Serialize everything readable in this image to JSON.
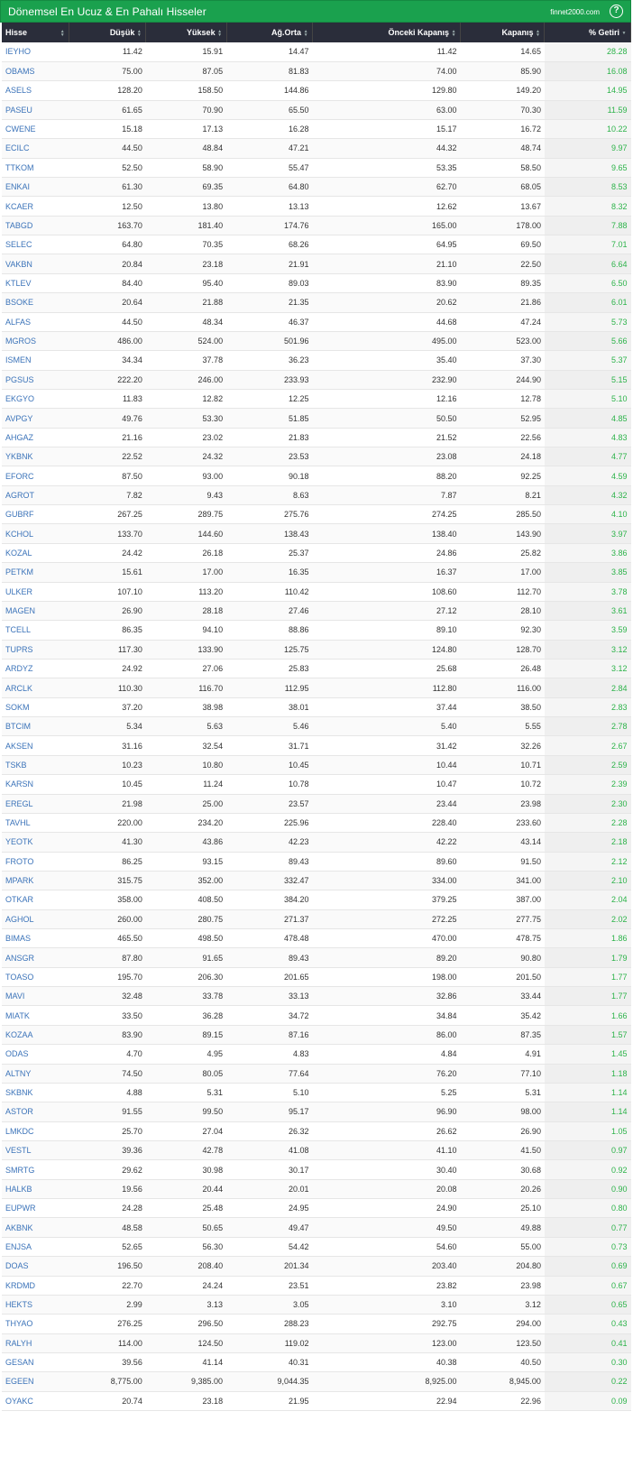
{
  "header": {
    "title": "Dönemsel En Ucuz & En Pahalı Hisseler",
    "site": "finnet2000.com",
    "help_icon": "?"
  },
  "columns": [
    "Hisse",
    "Düşük",
    "Yüksek",
    "Ağ.Orta",
    "Önceki Kapanış",
    "Kapanış",
    "% Getiri"
  ],
  "colors": {
    "header_bg": "#1aa14e",
    "thead_bg": "#2a2d3a",
    "symbol": "#3b73b9",
    "positive": "#2db34a"
  },
  "rows": [
    [
      "IEYHO",
      "11.42",
      "15.91",
      "14.47",
      "11.42",
      "14.65",
      "28.28"
    ],
    [
      "OBAMS",
      "75.00",
      "87.05",
      "81.83",
      "74.00",
      "85.90",
      "16.08"
    ],
    [
      "ASELS",
      "128.20",
      "158.50",
      "144.86",
      "129.80",
      "149.20",
      "14.95"
    ],
    [
      "PASEU",
      "61.65",
      "70.90",
      "65.50",
      "63.00",
      "70.30",
      "11.59"
    ],
    [
      "CWENE",
      "15.18",
      "17.13",
      "16.28",
      "15.17",
      "16.72",
      "10.22"
    ],
    [
      "ECILC",
      "44.50",
      "48.84",
      "47.21",
      "44.32",
      "48.74",
      "9.97"
    ],
    [
      "TTKOM",
      "52.50",
      "58.90",
      "55.47",
      "53.35",
      "58.50",
      "9.65"
    ],
    [
      "ENKAI",
      "61.30",
      "69.35",
      "64.80",
      "62.70",
      "68.05",
      "8.53"
    ],
    [
      "KCAER",
      "12.50",
      "13.80",
      "13.13",
      "12.62",
      "13.67",
      "8.32"
    ],
    [
      "TABGD",
      "163.70",
      "181.40",
      "174.76",
      "165.00",
      "178.00",
      "7.88"
    ],
    [
      "SELEC",
      "64.80",
      "70.35",
      "68.26",
      "64.95",
      "69.50",
      "7.01"
    ],
    [
      "VAKBN",
      "20.84",
      "23.18",
      "21.91",
      "21.10",
      "22.50",
      "6.64"
    ],
    [
      "KTLEV",
      "84.40",
      "95.40",
      "89.03",
      "83.90",
      "89.35",
      "6.50"
    ],
    [
      "BSOKE",
      "20.64",
      "21.88",
      "21.35",
      "20.62",
      "21.86",
      "6.01"
    ],
    [
      "ALFAS",
      "44.50",
      "48.34",
      "46.37",
      "44.68",
      "47.24",
      "5.73"
    ],
    [
      "MGROS",
      "486.00",
      "524.00",
      "501.96",
      "495.00",
      "523.00",
      "5.66"
    ],
    [
      "ISMEN",
      "34.34",
      "37.78",
      "36.23",
      "35.40",
      "37.30",
      "5.37"
    ],
    [
      "PGSUS",
      "222.20",
      "246.00",
      "233.93",
      "232.90",
      "244.90",
      "5.15"
    ],
    [
      "EKGYO",
      "11.83",
      "12.82",
      "12.25",
      "12.16",
      "12.78",
      "5.10"
    ],
    [
      "AVPGY",
      "49.76",
      "53.30",
      "51.85",
      "50.50",
      "52.95",
      "4.85"
    ],
    [
      "AHGAZ",
      "21.16",
      "23.02",
      "21.83",
      "21.52",
      "22.56",
      "4.83"
    ],
    [
      "YKBNK",
      "22.52",
      "24.32",
      "23.53",
      "23.08",
      "24.18",
      "4.77"
    ],
    [
      "EFORC",
      "87.50",
      "93.00",
      "90.18",
      "88.20",
      "92.25",
      "4.59"
    ],
    [
      "AGROT",
      "7.82",
      "9.43",
      "8.63",
      "7.87",
      "8.21",
      "4.32"
    ],
    [
      "GUBRF",
      "267.25",
      "289.75",
      "275.76",
      "274.25",
      "285.50",
      "4.10"
    ],
    [
      "KCHOL",
      "133.70",
      "144.60",
      "138.43",
      "138.40",
      "143.90",
      "3.97"
    ],
    [
      "KOZAL",
      "24.42",
      "26.18",
      "25.37",
      "24.86",
      "25.82",
      "3.86"
    ],
    [
      "PETKM",
      "15.61",
      "17.00",
      "16.35",
      "16.37",
      "17.00",
      "3.85"
    ],
    [
      "ULKER",
      "107.10",
      "113.20",
      "110.42",
      "108.60",
      "112.70",
      "3.78"
    ],
    [
      "MAGEN",
      "26.90",
      "28.18",
      "27.46",
      "27.12",
      "28.10",
      "3.61"
    ],
    [
      "TCELL",
      "86.35",
      "94.10",
      "88.86",
      "89.10",
      "92.30",
      "3.59"
    ],
    [
      "TUPRS",
      "117.30",
      "133.90",
      "125.75",
      "124.80",
      "128.70",
      "3.12"
    ],
    [
      "ARDYZ",
      "24.92",
      "27.06",
      "25.83",
      "25.68",
      "26.48",
      "3.12"
    ],
    [
      "ARCLK",
      "110.30",
      "116.70",
      "112.95",
      "112.80",
      "116.00",
      "2.84"
    ],
    [
      "SOKM",
      "37.20",
      "38.98",
      "38.01",
      "37.44",
      "38.50",
      "2.83"
    ],
    [
      "BTCIM",
      "5.34",
      "5.63",
      "5.46",
      "5.40",
      "5.55",
      "2.78"
    ],
    [
      "AKSEN",
      "31.16",
      "32.54",
      "31.71",
      "31.42",
      "32.26",
      "2.67"
    ],
    [
      "TSKB",
      "10.23",
      "10.80",
      "10.45",
      "10.44",
      "10.71",
      "2.59"
    ],
    [
      "KARSN",
      "10.45",
      "11.24",
      "10.78",
      "10.47",
      "10.72",
      "2.39"
    ],
    [
      "EREGL",
      "21.98",
      "25.00",
      "23.57",
      "23.44",
      "23.98",
      "2.30"
    ],
    [
      "TAVHL",
      "220.00",
      "234.20",
      "225.96",
      "228.40",
      "233.60",
      "2.28"
    ],
    [
      "YEOTK",
      "41.30",
      "43.86",
      "42.23",
      "42.22",
      "43.14",
      "2.18"
    ],
    [
      "FROTO",
      "86.25",
      "93.15",
      "89.43",
      "89.60",
      "91.50",
      "2.12"
    ],
    [
      "MPARK",
      "315.75",
      "352.00",
      "332.47",
      "334.00",
      "341.00",
      "2.10"
    ],
    [
      "OTKAR",
      "358.00",
      "408.50",
      "384.20",
      "379.25",
      "387.00",
      "2.04"
    ],
    [
      "AGHOL",
      "260.00",
      "280.75",
      "271.37",
      "272.25",
      "277.75",
      "2.02"
    ],
    [
      "BIMAS",
      "465.50",
      "498.50",
      "478.48",
      "470.00",
      "478.75",
      "1.86"
    ],
    [
      "ANSGR",
      "87.80",
      "91.65",
      "89.43",
      "89.20",
      "90.80",
      "1.79"
    ],
    [
      "TOASO",
      "195.70",
      "206.30",
      "201.65",
      "198.00",
      "201.50",
      "1.77"
    ],
    [
      "MAVI",
      "32.48",
      "33.78",
      "33.13",
      "32.86",
      "33.44",
      "1.77"
    ],
    [
      "MIATK",
      "33.50",
      "36.28",
      "34.72",
      "34.84",
      "35.42",
      "1.66"
    ],
    [
      "KOZAA",
      "83.90",
      "89.15",
      "87.16",
      "86.00",
      "87.35",
      "1.57"
    ],
    [
      "ODAS",
      "4.70",
      "4.95",
      "4.83",
      "4.84",
      "4.91",
      "1.45"
    ],
    [
      "ALTNY",
      "74.50",
      "80.05",
      "77.64",
      "76.20",
      "77.10",
      "1.18"
    ],
    [
      "SKBNK",
      "4.88",
      "5.31",
      "5.10",
      "5.25",
      "5.31",
      "1.14"
    ],
    [
      "ASTOR",
      "91.55",
      "99.50",
      "95.17",
      "96.90",
      "98.00",
      "1.14"
    ],
    [
      "LMKDC",
      "25.70",
      "27.04",
      "26.32",
      "26.62",
      "26.90",
      "1.05"
    ],
    [
      "VESTL",
      "39.36",
      "42.78",
      "41.08",
      "41.10",
      "41.50",
      "0.97"
    ],
    [
      "SMRTG",
      "29.62",
      "30.98",
      "30.17",
      "30.40",
      "30.68",
      "0.92"
    ],
    [
      "HALKB",
      "19.56",
      "20.44",
      "20.01",
      "20.08",
      "20.26",
      "0.90"
    ],
    [
      "EUPWR",
      "24.28",
      "25.48",
      "24.95",
      "24.90",
      "25.10",
      "0.80"
    ],
    [
      "AKBNK",
      "48.58",
      "50.65",
      "49.47",
      "49.50",
      "49.88",
      "0.77"
    ],
    [
      "ENJSA",
      "52.65",
      "56.30",
      "54.42",
      "54.60",
      "55.00",
      "0.73"
    ],
    [
      "DOAS",
      "196.50",
      "208.40",
      "201.34",
      "203.40",
      "204.80",
      "0.69"
    ],
    [
      "KRDMD",
      "22.70",
      "24.24",
      "23.51",
      "23.82",
      "23.98",
      "0.67"
    ],
    [
      "HEKTS",
      "2.99",
      "3.13",
      "3.05",
      "3.10",
      "3.12",
      "0.65"
    ],
    [
      "THYAO",
      "276.25",
      "296.50",
      "288.23",
      "292.75",
      "294.00",
      "0.43"
    ],
    [
      "RALYH",
      "114.00",
      "124.50",
      "119.02",
      "123.00",
      "123.50",
      "0.41"
    ],
    [
      "GESAN",
      "39.56",
      "41.14",
      "40.31",
      "40.38",
      "40.50",
      "0.30"
    ],
    [
      "EGEEN",
      "8,775.00",
      "9,385.00",
      "9,044.35",
      "8,925.00",
      "8,945.00",
      "0.22"
    ],
    [
      "OYAKC",
      "20.74",
      "23.18",
      "21.95",
      "22.94",
      "22.96",
      "0.09"
    ]
  ]
}
